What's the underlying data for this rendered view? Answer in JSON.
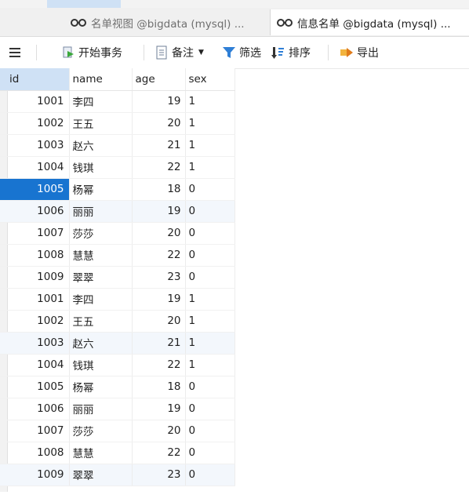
{
  "tabs": [
    {
      "label": "名单视图 @bigdata (mysql) ..."
    },
    {
      "label": "信息名单 @bigdata (mysql) ..."
    }
  ],
  "toolbar": {
    "start_transaction": "开始事务",
    "memo": "备注",
    "filter": "筛选",
    "sort": "排序",
    "export": "导出"
  },
  "columns": [
    "id",
    "name",
    "age",
    "sex"
  ],
  "rows": [
    {
      "id": "1001",
      "name": "李四",
      "age": "19",
      "sex": "1"
    },
    {
      "id": "1002",
      "name": "王五",
      "age": "20",
      "sex": "1"
    },
    {
      "id": "1003",
      "name": "赵六",
      "age": "21",
      "sex": "1"
    },
    {
      "id": "1004",
      "name": "钱琪",
      "age": "22",
      "sex": "1"
    },
    {
      "id": "1005",
      "name": "杨幂",
      "age": "18",
      "sex": "0"
    },
    {
      "id": "1006",
      "name": "丽丽",
      "age": "19",
      "sex": "0"
    },
    {
      "id": "1007",
      "name": "莎莎",
      "age": "20",
      "sex": "0"
    },
    {
      "id": "1008",
      "name": "慧慧",
      "age": "22",
      "sex": "0"
    },
    {
      "id": "1009",
      "name": "翠翠",
      "age": "23",
      "sex": "0"
    },
    {
      "id": "1001",
      "name": "李四",
      "age": "19",
      "sex": "1"
    },
    {
      "id": "1002",
      "name": "王五",
      "age": "20",
      "sex": "1"
    },
    {
      "id": "1003",
      "name": "赵六",
      "age": "21",
      "sex": "1"
    },
    {
      "id": "1004",
      "name": "钱琪",
      "age": "22",
      "sex": "1"
    },
    {
      "id": "1005",
      "name": "杨幂",
      "age": "18",
      "sex": "0"
    },
    {
      "id": "1006",
      "name": "丽丽",
      "age": "19",
      "sex": "0"
    },
    {
      "id": "1007",
      "name": "莎莎",
      "age": "20",
      "sex": "0"
    },
    {
      "id": "1008",
      "name": "慧慧",
      "age": "22",
      "sex": "0"
    },
    {
      "id": "1009",
      "name": "翠翠",
      "age": "23",
      "sex": "0"
    }
  ],
  "colors": {
    "accent": "#1874d0",
    "header_selected": "#cfe1f5",
    "row_alt": "#f3f7fc"
  }
}
